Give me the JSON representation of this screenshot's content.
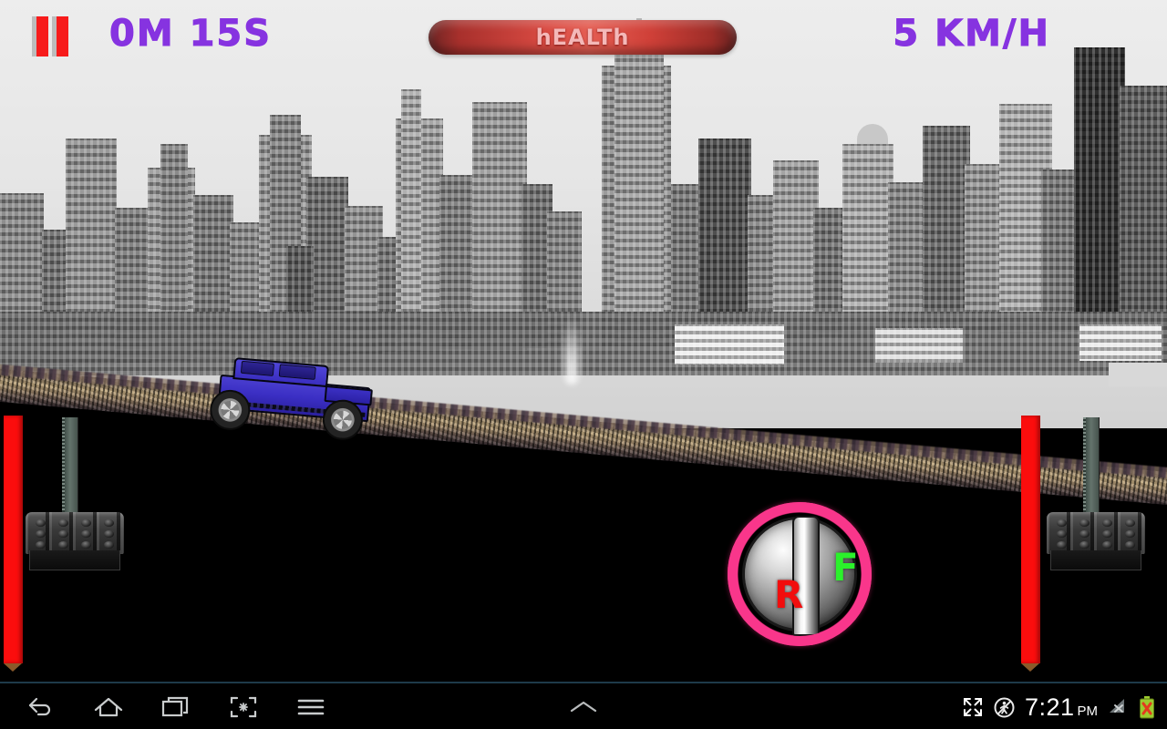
{
  "hud": {
    "pause_icon": "pause-icon",
    "timer": "0M 15S",
    "speed": "5 KM/H",
    "health_label": "hEALTh",
    "health_percent": 100,
    "accent_purple": "#8633e0",
    "health_red": "#d94a42",
    "pause_red": "#f71b1b"
  },
  "controls": {
    "gear_reverse": "R",
    "gear_forward": "F",
    "gear_ring_color": "#f9368b",
    "reverse_color": "#f20d0d",
    "forward_color": "#2bf22b",
    "brake_bar_color": "#fb0d0d",
    "left_pedal_name": "brake-pedal",
    "right_pedal_name": "gas-pedal"
  },
  "scene": {
    "sky_color": "#e8e8e8",
    "ground_color": "#000000",
    "terrain_color": "#c3ab81",
    "vehicle_color": "#3b2fc4",
    "vehicle_name": "blue-suv",
    "city": "grayscale-skyline"
  },
  "navbar": {
    "back": "back-icon",
    "home": "home-icon",
    "recents": "recent-apps-icon",
    "screenshot": "screenshot-icon",
    "menu": "menu-icon",
    "expand_center": "chevron-up-icon",
    "fullscreen": "fullscreen-icon",
    "silent": "silent-mode-icon",
    "time": "7:21",
    "ampm": "PM",
    "signal": "no-signal-icon",
    "battery": "battery-error-icon"
  }
}
